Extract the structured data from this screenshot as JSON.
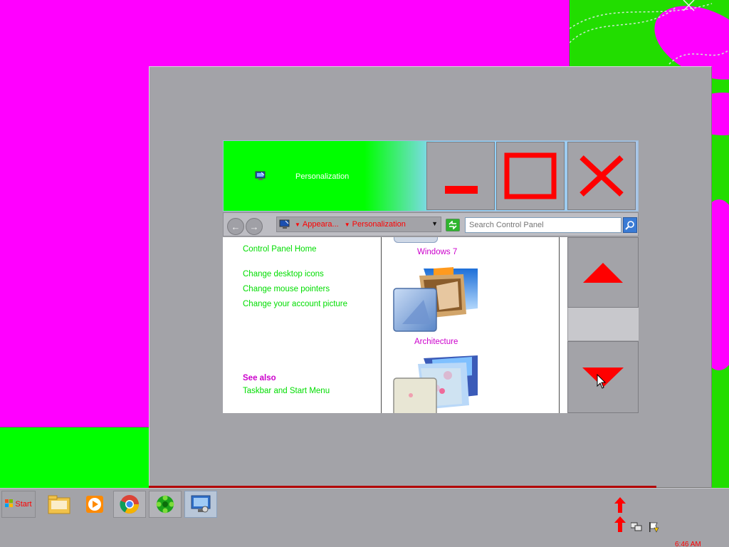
{
  "window": {
    "title": "Personalization"
  },
  "caption_buttons": {
    "minimize": "minimize",
    "maximize": "maximize",
    "close": "close"
  },
  "address_bar": {
    "crumbs": [
      "Appeara...",
      "Personalization"
    ],
    "search_placeholder": "Search Control Panel"
  },
  "left_pane": {
    "home_link": "Control Panel Home",
    "links": [
      "Change desktop icons",
      "Change mouse pointers",
      "Change your account picture"
    ],
    "see_also_heading": "See also",
    "see_also_links": [
      "Taskbar and Start Menu"
    ]
  },
  "themes": {
    "items": [
      "Windows 7",
      "Architecture"
    ]
  },
  "taskbar": {
    "start_label": "Start",
    "clock": "6:46 AM"
  },
  "colors": {
    "accent_red": "#ff0000",
    "link_green": "#00dd00",
    "magenta": "#ff00ff",
    "frame_gray": "#a3a3a8"
  }
}
